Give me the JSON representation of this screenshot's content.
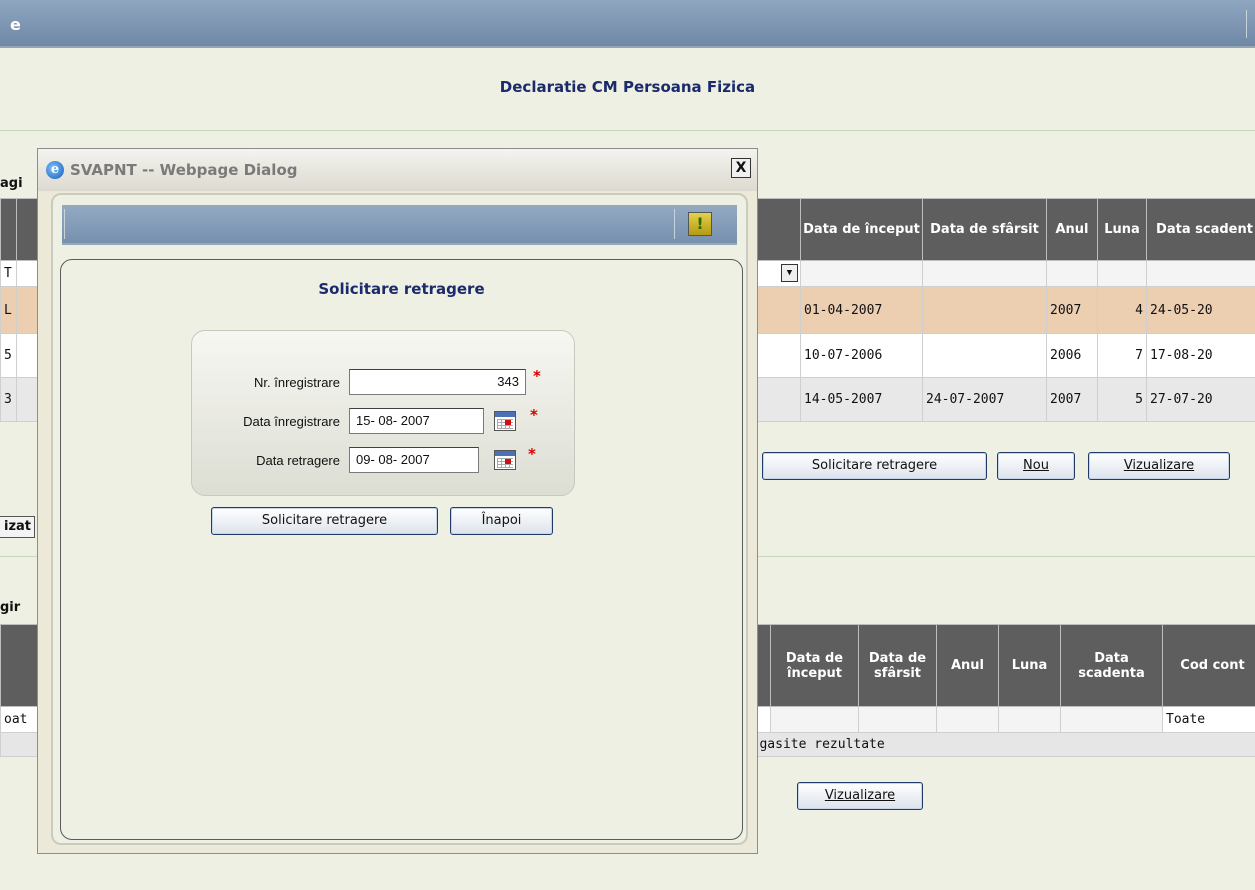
{
  "app": {
    "title_fragment": "e",
    "page_title": "Declaratie CM Persoana Fizica",
    "fragments": {
      "pagina1": "agi",
      "pagina2": "gir",
      "lizat": "izat",
      "toate_left": "oat"
    }
  },
  "grid1": {
    "headers": [
      "Data de început",
      "Data de sfârsit",
      "Anul",
      "Luna",
      "Data scadent"
    ],
    "filter_left": "T",
    "rows": [
      {
        "left": "L",
        "start": "01-04-2007",
        "end": "",
        "year": "2007",
        "month": "4",
        "due": "24-05-20"
      },
      {
        "left": "5",
        "start": "10-07-2006",
        "end": "",
        "year": "2006",
        "month": "7",
        "due": "17-08-20"
      },
      {
        "left": "3",
        "start": "14-05-2007",
        "end": "24-07-2007",
        "year": "2007",
        "month": "5",
        "due": "27-07-20"
      }
    ],
    "buttons": {
      "solicitare": "Solicitare retragere",
      "nou": "Nou",
      "vizualizare": "Vizualizare"
    }
  },
  "grid2": {
    "headers": [
      "Data de început",
      "Data de sfârsit",
      "Anul",
      "Luna",
      "Data scadenta",
      "Cod cont"
    ],
    "filter_select": "Toate",
    "no_results": "st gasite rezultate",
    "buttons": {
      "vizualizare": "Vizualizare"
    }
  },
  "dialog": {
    "title": "SVAPNT -- Webpage Dialog",
    "close": "X",
    "warning": "!",
    "heading": "Solicitare retragere",
    "fields": {
      "nr_label": "Nr. înregistrare",
      "nr_value": "343",
      "data_inreg_label": "Data înregistrare",
      "data_inreg_value": "15- 08- 2007",
      "data_retr_label": "Data retragere",
      "data_retr_value": "09- 08- 2007",
      "required": "*"
    },
    "buttons": {
      "submit": "Solicitare retragere",
      "back": "Înapoi"
    }
  },
  "colors": {
    "accent": "#1a2a6a",
    "header": "#5e5e5e",
    "selected_row": "#ecceb1",
    "bar": "#7690ae"
  },
  "icons": [
    "ie-icon",
    "close-icon",
    "warning-icon",
    "calendar-icon",
    "combo-arrow-icon"
  ]
}
